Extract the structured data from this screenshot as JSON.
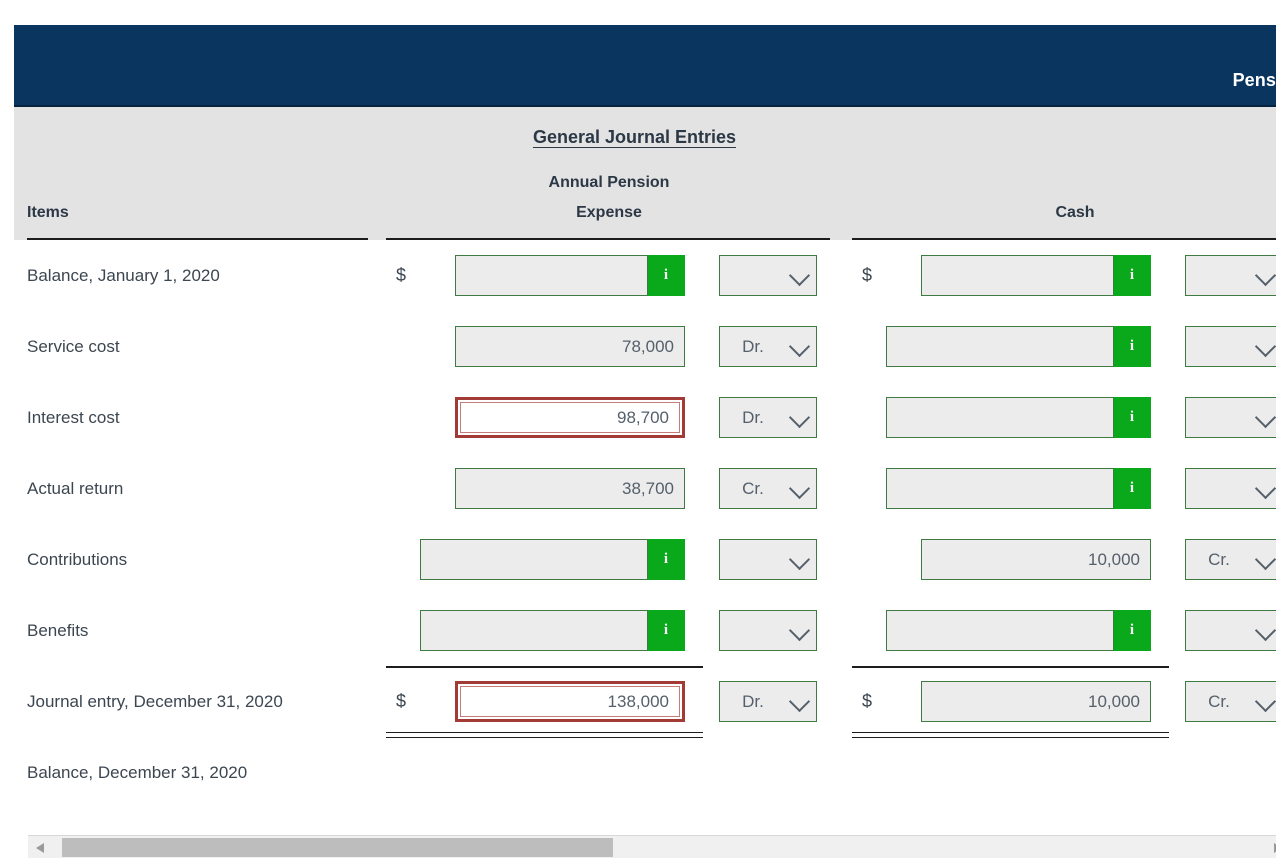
{
  "window": {
    "title": "Pens"
  },
  "header": {
    "general_journal_entries": "General Journal Entries",
    "col_items": "Items",
    "col_annual_pension_expense_line1": "Annual Pension",
    "col_annual_pension_expense_line2": "Expense",
    "col_cash": "Cash"
  },
  "icons": {
    "info": "i",
    "chevron_down": "chevron-down-icon",
    "scroll_left": "triangle-left-icon",
    "scroll_right": "triangle-right-icon"
  },
  "colors": {
    "titlebar": "#09355f",
    "header_band": "#e3e3e3",
    "field_border_green": "#3f7a42",
    "info_button_green": "#0aa81b",
    "error_border_red": "#a23a36",
    "field_fill": "#ececec",
    "text": "#3c4650"
  },
  "rows": [
    {
      "label": "Balance, January 1, 2020",
      "ape": {
        "dollar": "$",
        "value": "",
        "has_info": true,
        "error": false,
        "dr_cr": ""
      },
      "cash": {
        "dollar": "$",
        "value": "",
        "has_info": true,
        "error": false,
        "dr_cr": ""
      }
    },
    {
      "label": "Service cost",
      "ape": {
        "dollar": "",
        "value": "78,000",
        "has_info": false,
        "error": false,
        "dr_cr": "Dr."
      },
      "cash": {
        "dollar": "",
        "value": "",
        "has_info": true,
        "error": false,
        "dr_cr": ""
      }
    },
    {
      "label": "Interest cost",
      "ape": {
        "dollar": "",
        "value": "98,700",
        "has_info": false,
        "error": true,
        "dr_cr": "Dr."
      },
      "cash": {
        "dollar": "",
        "value": "",
        "has_info": true,
        "error": false,
        "dr_cr": ""
      }
    },
    {
      "label": "Actual return",
      "ape": {
        "dollar": "",
        "value": "38,700",
        "has_info": false,
        "error": false,
        "dr_cr": "Cr."
      },
      "cash": {
        "dollar": "",
        "value": "",
        "has_info": true,
        "error": false,
        "dr_cr": ""
      }
    },
    {
      "label": "Contributions",
      "ape": {
        "dollar": "",
        "value": "",
        "has_info": true,
        "error": false,
        "dr_cr": ""
      },
      "cash": {
        "dollar": "",
        "value": "10,000",
        "has_info": false,
        "error": false,
        "dr_cr": "Cr."
      }
    },
    {
      "label": "Benefits",
      "ape": {
        "dollar": "",
        "value": "",
        "has_info": true,
        "error": false,
        "dr_cr": ""
      },
      "cash": {
        "dollar": "",
        "value": "",
        "has_info": true,
        "error": false,
        "dr_cr": ""
      }
    },
    {
      "label": "Journal entry, December 31, 2020",
      "ape": {
        "dollar": "$",
        "value": "138,000",
        "has_info": false,
        "error": true,
        "dr_cr": "Dr."
      },
      "cash": {
        "dollar": "$",
        "value": "10,000",
        "has_info": false,
        "error": false,
        "dr_cr": "Cr."
      }
    },
    {
      "label": "Balance, December 31, 2020",
      "ape": null,
      "cash": null
    }
  ]
}
